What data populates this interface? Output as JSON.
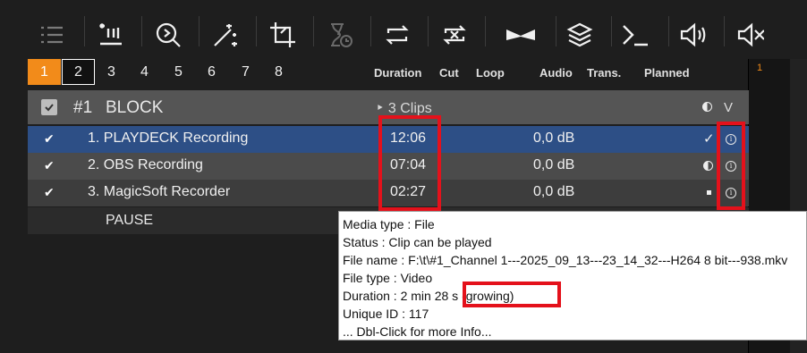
{
  "toolbar": {
    "icons": [
      "list-icon",
      "pause-icon",
      "search-icon",
      "magic-wand-icon",
      "crop-icon",
      "timer-icon",
      "loop-icon",
      "shuffle-icon",
      "bowtie-icon",
      "layers-icon",
      "terminal-icon",
      "speaker-icon",
      "mute-icon"
    ]
  },
  "tabs": [
    "1",
    "2",
    "3",
    "4",
    "5",
    "6",
    "7",
    "8"
  ],
  "columns": {
    "duration": "Duration",
    "cut": "Cut",
    "loop": "Loop",
    "audio": "Audio",
    "trans": "Trans.",
    "planned": "Planned"
  },
  "side_number": "1",
  "block": {
    "number": "#1",
    "title": "BLOCK",
    "clips": "‣ 3 Clips",
    "chevron": "V"
  },
  "rows": [
    {
      "name": "1. PLAYDECK Recording",
      "duration": "12:06",
      "audio": "0,0 dB",
      "mark": "✓"
    },
    {
      "name": "2. OBS Recording",
      "duration": "07:04",
      "audio": "0,0 dB",
      "mark": ""
    },
    {
      "name": "3. MagicSoft Recorder",
      "duration": "02:27",
      "audio": "0,0 dB",
      "mark": ""
    }
  ],
  "pause_label": "PAUSE",
  "tooltip": {
    "lines": [
      "Media type : File",
      "Status : Clip can be played",
      "File name : F:\\t\\#1_Channel 1---2025_09_13---23_14_32---H264  8 bit---938.mkv",
      "File type : Video",
      "Duration : 2 min 28 s (growing)",
      "Unique ID : 117",
      "... Dbl-Click for more Info..."
    ]
  },
  "colors": {
    "accent_tab": "#f28b1a",
    "selected_row": "#2d4f86",
    "highlight": "#e4111b"
  }
}
